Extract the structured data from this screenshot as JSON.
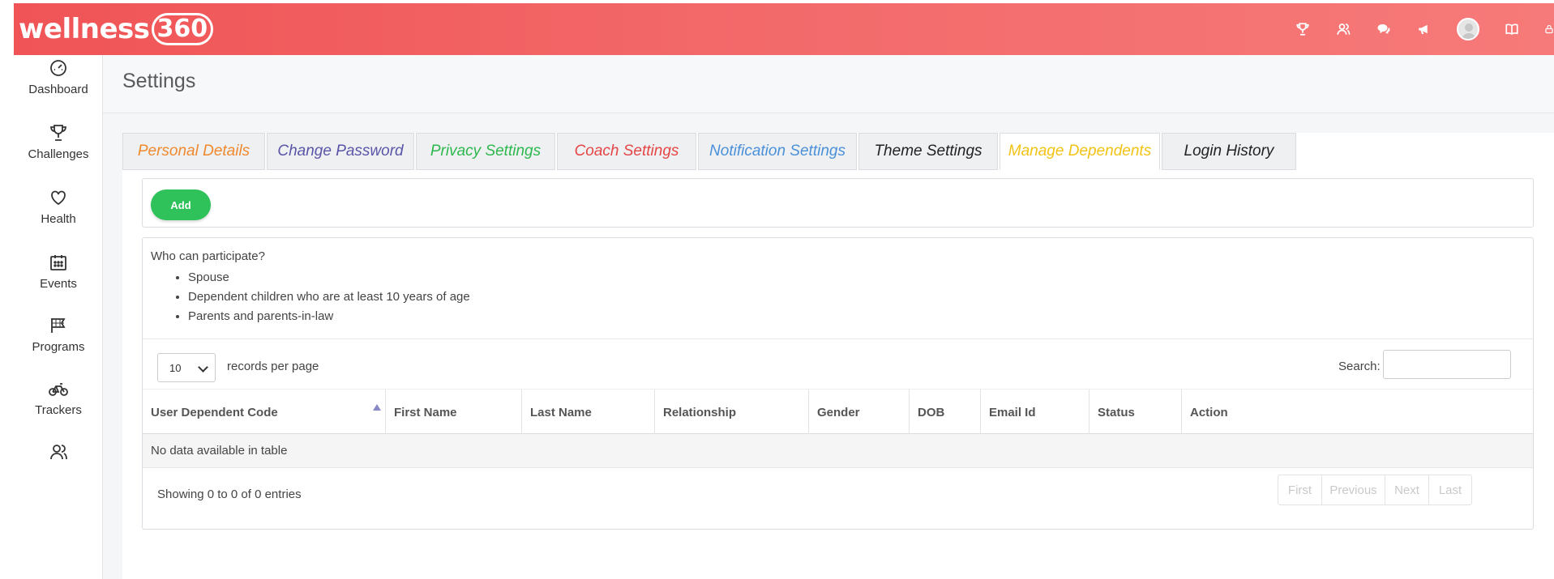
{
  "brand": {
    "name": "wellness",
    "suffix": "360"
  },
  "header_icons": [
    "trophy-icon",
    "users-icon",
    "chat-icon",
    "megaphone-icon",
    "avatar",
    "book-icon",
    "lock-icon"
  ],
  "sidebar": {
    "items": [
      {
        "label": "Dashboard",
        "icon": "speedometer-icon"
      },
      {
        "label": "Challenges",
        "icon": "trophy-icon"
      },
      {
        "label": "Health",
        "icon": "heart-icon"
      },
      {
        "label": "Events",
        "icon": "calendar-icon"
      },
      {
        "label": "Programs",
        "icon": "flag-icon"
      },
      {
        "label": "Trackers",
        "icon": "bicycle-icon"
      },
      {
        "label": "",
        "icon": "users-icon"
      }
    ]
  },
  "page": {
    "title": "Settings"
  },
  "tabs": [
    {
      "label": "Personal Details",
      "color": "#f0892e"
    },
    {
      "label": "Change Password",
      "color": "#5a55a8"
    },
    {
      "label": "Privacy Settings",
      "color": "#2db84d"
    },
    {
      "label": "Coach Settings",
      "color": "#e64545"
    },
    {
      "label": "Notification Settings",
      "color": "#4a90d9"
    },
    {
      "label": "Theme Settings",
      "color": "#222222"
    },
    {
      "label": "Manage Dependents",
      "color": "#f2c314",
      "active": true
    },
    {
      "label": "Login History",
      "color": "#222222"
    }
  ],
  "add_button": {
    "label": "Add"
  },
  "eligibility": {
    "heading": "Who can participate?",
    "items": [
      "Spouse",
      "Dependent children who are at least 10 years of age",
      "Parents and parents-in-law"
    ]
  },
  "table_controls": {
    "page_length": "10",
    "page_length_label": "records per page",
    "search_label": "Search:",
    "search_value": ""
  },
  "table": {
    "columns": [
      "User Dependent Code",
      "First Name",
      "Last Name",
      "Relationship",
      "Gender",
      "DOB",
      "Email Id",
      "Status",
      "Action"
    ],
    "empty_message": "No data available in table",
    "info": "Showing 0 to 0 of 0 entries"
  },
  "pagination": [
    "First",
    "Previous",
    "Next",
    "Last"
  ],
  "colors": {
    "header_start": "#f05456",
    "header_end": "#f67a79",
    "add_button": "#2fc15a"
  }
}
